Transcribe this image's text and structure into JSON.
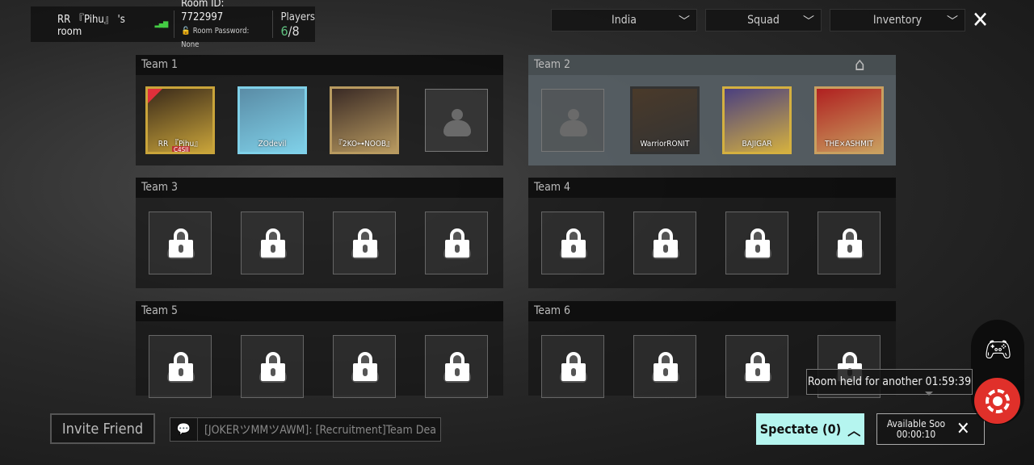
{
  "room": {
    "name": "RR 『Pihu』 's room",
    "room_id": "Room ID: 7722997",
    "password": "Room Password: None",
    "players_label": "Players",
    "players_current": "6",
    "players_max": "/8"
  },
  "filters": {
    "region": "India",
    "mode": "Squad",
    "inventory": "Inventory"
  },
  "teams": [
    {
      "label": "Team 1",
      "slots": [
        {
          "type": "player",
          "name": "RR 『Pihu』",
          "tag": "C4SII",
          "host": true,
          "colors": [
            "#3a2a1a",
            "#c9a43a"
          ]
        },
        {
          "type": "player",
          "name": "ZOdevil",
          "colors": [
            "#5a8ca6",
            "#7fd0e8"
          ]
        },
        {
          "type": "player",
          "name": "『2KO⊶NOOB』",
          "colors": [
            "#3a2a25",
            "#b89a60"
          ]
        },
        {
          "type": "empty"
        }
      ]
    },
    {
      "label": "Team 2",
      "highlighted": true,
      "slots": [
        {
          "type": "empty"
        },
        {
          "type": "player",
          "name": "WarriorRONIT",
          "colors": [
            "#4a3a2a",
            "#333"
          ]
        },
        {
          "type": "player",
          "name": "BAJIGAR",
          "colors": [
            "#4a3f80",
            "#d4b040"
          ]
        },
        {
          "type": "player",
          "name": "THE×ASHMIT",
          "colors": [
            "#b02020",
            "#c9a060"
          ]
        }
      ]
    },
    {
      "label": "Team 3",
      "slots": [
        {
          "type": "locked"
        },
        {
          "type": "locked"
        },
        {
          "type": "locked"
        },
        {
          "type": "locked"
        }
      ]
    },
    {
      "label": "Team 4",
      "slots": [
        {
          "type": "locked"
        },
        {
          "type": "locked"
        },
        {
          "type": "locked"
        },
        {
          "type": "locked"
        }
      ]
    },
    {
      "label": "Team 5",
      "slots": [
        {
          "type": "locked"
        },
        {
          "type": "locked"
        },
        {
          "type": "locked"
        },
        {
          "type": "locked"
        }
      ]
    },
    {
      "label": "Team 6",
      "slots": [
        {
          "type": "locked"
        },
        {
          "type": "locked"
        },
        {
          "type": "locked"
        },
        {
          "type": "locked"
        }
      ]
    }
  ],
  "bottom": {
    "invite": "Invite Friend",
    "chat": "[JOKERツMMツAWM]: [Recruitment]Team Dea",
    "spectate": "Spectate (0)",
    "available_label": "Available Soo",
    "available_timer": "00:00:10",
    "room_held": "Room held for another 01:59:39"
  },
  "colors": {
    "spectate_bg": "#b5f5ef",
    "record": "#e0302a",
    "players_current": "#5fbf7f"
  }
}
